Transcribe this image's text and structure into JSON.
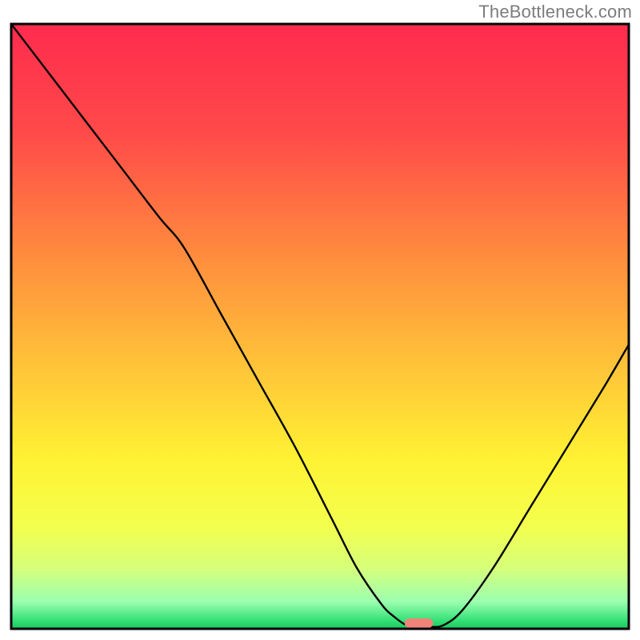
{
  "watermark": "TheBottleneck.com",
  "chart_data": {
    "type": "line",
    "title": "",
    "xlabel": "",
    "ylabel": "",
    "x_range": [
      0,
      100
    ],
    "y_range": [
      0,
      100
    ],
    "series": [
      {
        "name": "bottleneck-curve",
        "x": [
          0,
          6,
          12,
          18,
          24,
          28,
          34,
          40,
          46,
          52,
          56,
          60,
          62,
          64,
          66,
          68,
          70,
          73,
          78,
          84,
          90,
          96,
          100
        ],
        "y": [
          100,
          92,
          84,
          76,
          68,
          63,
          52,
          41,
          30,
          18,
          10,
          4,
          2,
          0.6,
          0.3,
          0.3,
          0.6,
          3,
          10,
          20,
          30,
          40,
          47
        ]
      }
    ],
    "marker": {
      "name": "optimal-pill",
      "x": 66,
      "width": 4.6,
      "color": "#f08478"
    },
    "gradient_stops": [
      {
        "offset": 0,
        "color": "#ff2b4e"
      },
      {
        "offset": 0.18,
        "color": "#ff4a49"
      },
      {
        "offset": 0.38,
        "color": "#ff8b3e"
      },
      {
        "offset": 0.58,
        "color": "#ffc838"
      },
      {
        "offset": 0.72,
        "color": "#fff233"
      },
      {
        "offset": 0.83,
        "color": "#f3ff4d"
      },
      {
        "offset": 0.9,
        "color": "#d6ff7a"
      },
      {
        "offset": 0.955,
        "color": "#9cffb0"
      },
      {
        "offset": 0.985,
        "color": "#38e27a"
      },
      {
        "offset": 1.0,
        "color": "#17c85a"
      }
    ],
    "frame_color": "#000000",
    "curve_color": "#000000",
    "curve_width": 2.4
  }
}
